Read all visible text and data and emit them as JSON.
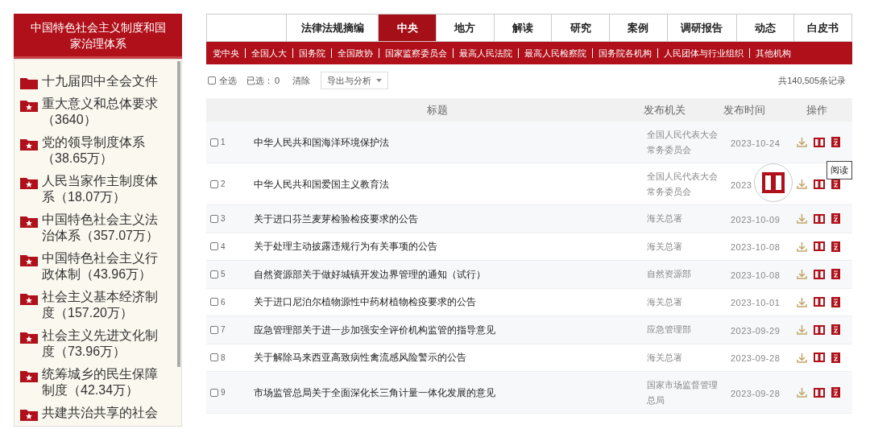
{
  "sidebar": {
    "title": "中国特色社会主义制度和国家治理体系",
    "items": [
      {
        "kind": "folder",
        "label": "十九届四中全会文件"
      },
      {
        "kind": "star-folder",
        "label": "重大意义和总体要求（3640）"
      },
      {
        "kind": "star-folder",
        "label": "党的领导制度体系（38.65万）"
      },
      {
        "kind": "star-folder",
        "label": "人民当家作主制度体系（18.07万）"
      },
      {
        "kind": "star-folder",
        "label": "中国特色社会主义法治体系（357.07万）"
      },
      {
        "kind": "star-folder",
        "label": "中国特色社会主义行政体制（43.96万）"
      },
      {
        "kind": "star-folder",
        "label": "社会主义基本经济制度（157.20万）"
      },
      {
        "kind": "star-folder",
        "label": "社会主义先进文化制度（73.96万）"
      },
      {
        "kind": "star-folder",
        "label": "统筹城乡的民生保障制度（42.34万）"
      },
      {
        "kind": "star-folder",
        "label": "共建共治共享的社会"
      }
    ]
  },
  "tabs": [
    {
      "label": "法律法规摘编",
      "selected": false
    },
    {
      "label": "中央",
      "selected": true
    },
    {
      "label": "地方",
      "selected": false
    },
    {
      "label": "解读",
      "selected": false
    },
    {
      "label": "研究",
      "selected": false
    },
    {
      "label": "案例",
      "selected": false
    },
    {
      "label": "调研报告",
      "selected": false
    },
    {
      "label": "动态",
      "selected": false
    },
    {
      "label": "白皮书",
      "selected": false
    }
  ],
  "subnav": [
    "党中央",
    "全国人大",
    "国务院",
    "全国政协",
    "国家监察委员会",
    "最高人民法院",
    "最高人民检察院",
    "国务院各机构",
    "人民团体与行业组织",
    "其他机构"
  ],
  "toolbar": {
    "select_all": {
      "label": "全选",
      "checked": false
    },
    "selected_label": "已选：",
    "selected_count": "0",
    "clear": "清除",
    "export": "导出与分析",
    "total": "共140,505条记录"
  },
  "table": {
    "columns": [
      "标题",
      "发布机关",
      "发布时间",
      "操作"
    ],
    "rows": [
      {
        "checked": false,
        "num": "1",
        "title": "中华人民共和国海洋环境保护法",
        "agency": "全国人民代表大会常务委员会",
        "date": "2023-10-24"
      },
      {
        "checked": false,
        "num": "2",
        "title": "中华人民共和国爱国主义教育法",
        "agency": "全国人民代表大会常务委员会",
        "date": "2023",
        "magnified": true
      },
      {
        "checked": false,
        "num": "3",
        "title": "关于进口芬兰麦芽检验检疫要求的公告",
        "agency": "海关总署",
        "date": "2023-10-09"
      },
      {
        "checked": false,
        "num": "4",
        "title": "关于处理主动披露违规行为有关事项的公告",
        "agency": "海关总署",
        "date": "2023-10-08"
      },
      {
        "checked": false,
        "num": "5",
        "title": "自然资源部关于做好城镇开发边界管理的通知（试行）",
        "agency": "自然资源部",
        "date": "2023-10-08"
      },
      {
        "checked": false,
        "num": "6",
        "title": "关于进口尼泊尔植物源性中药材植物检疫要求的公告",
        "agency": "海关总署",
        "date": "2023-10-01"
      },
      {
        "checked": false,
        "num": "7",
        "title": "应急管理部关于进一步加强安全评价机构监管的指导意见",
        "agency": "应急管理部",
        "date": "2023-09-29"
      },
      {
        "checked": false,
        "num": "8",
        "title": "关于解除马来西亚高致病性禽流感风险警示的公告",
        "agency": "海关总署",
        "date": "2023-09-28"
      },
      {
        "checked": false,
        "num": "9",
        "title": "市场监管总局关于全面深化长三角计量一体化发展的意见",
        "agency": "国家市场监督管理总局",
        "date": "2023-09-28"
      }
    ]
  },
  "tooltip": "阅读"
}
